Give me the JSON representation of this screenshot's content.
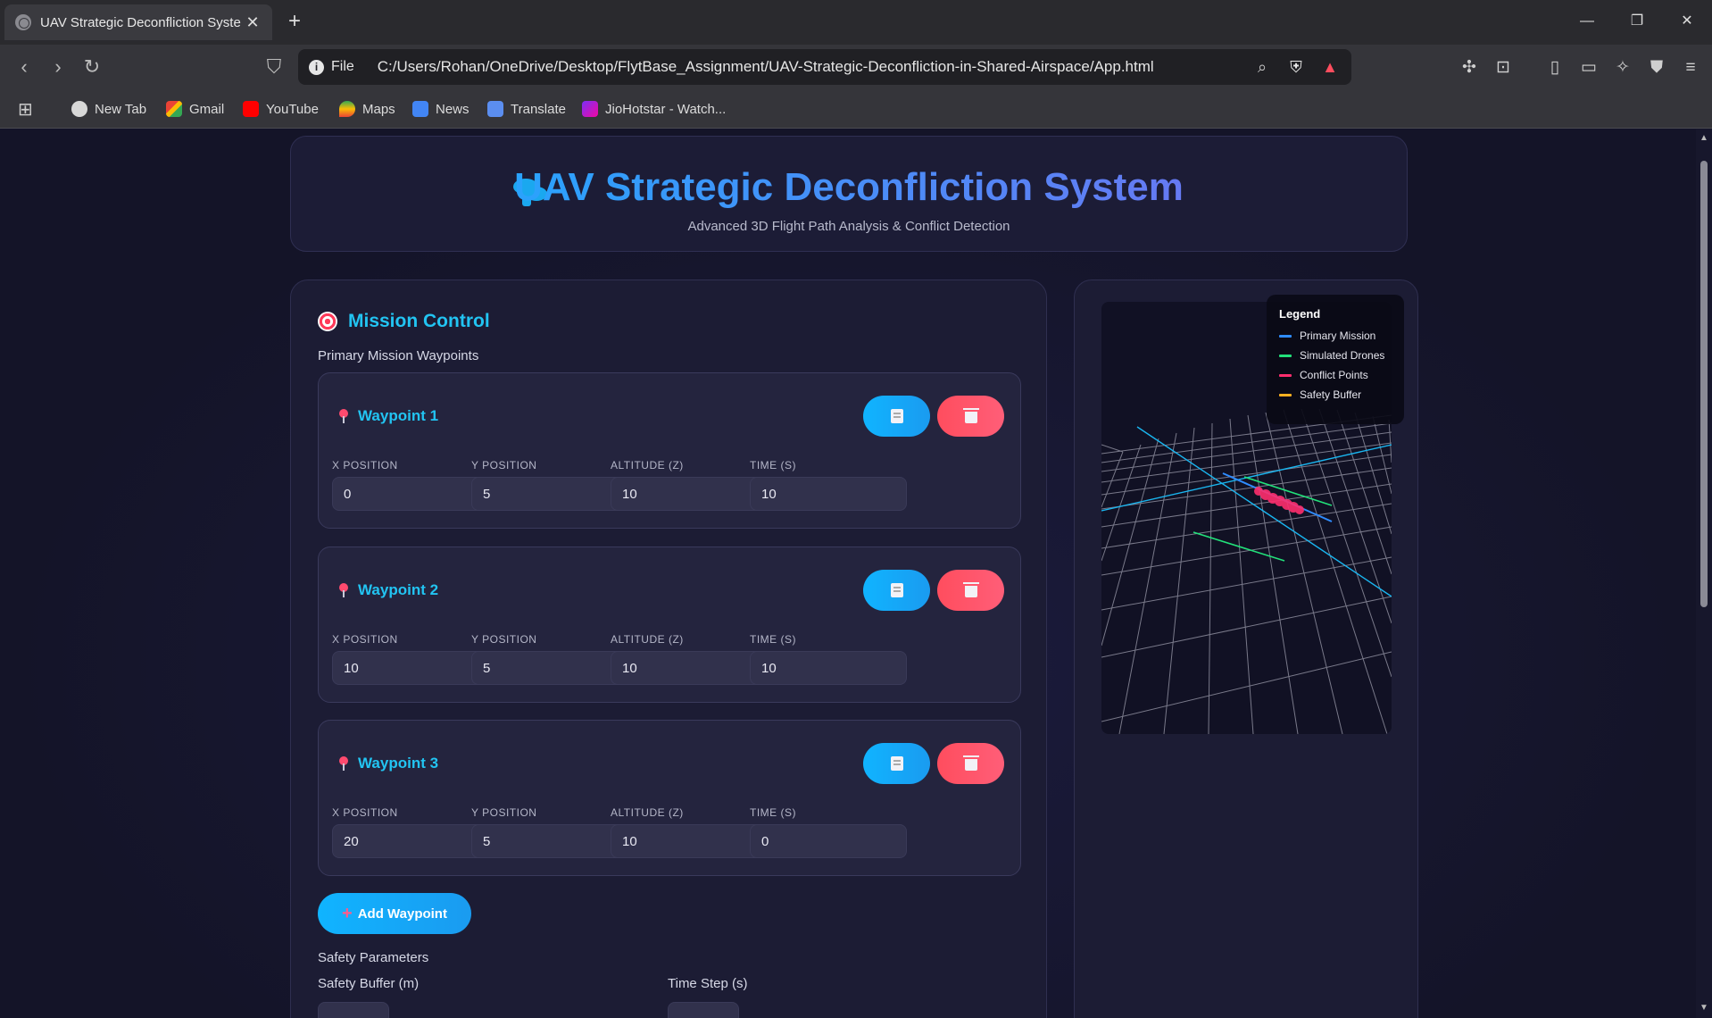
{
  "browser": {
    "tab_title": "UAV Strategic Deconfliction Syste",
    "url_scheme": "File",
    "url": "C:/Users/Rohan/OneDrive/Desktop/FlytBase_Assignment/UAV-Strategic-Deconfliction-in-Shared-Airspace/App.html",
    "bookmarks": [
      "New Tab",
      "Gmail",
      "YouTube",
      "Maps",
      "News",
      "Translate",
      "JioHotstar - Watch..."
    ]
  },
  "header": {
    "title": "UAV Strategic Deconfliction System",
    "subtitle": "Advanced 3D Flight Path Analysis & Conflict Detection"
  },
  "mission": {
    "title": "Mission Control",
    "waypoints_label": "Primary Mission Waypoints",
    "field_labels": {
      "x": "X POSITION",
      "y": "Y POSITION",
      "z": "ALTITUDE (Z)",
      "t": "TIME (S)"
    },
    "waypoints": [
      {
        "name": "Waypoint 1",
        "x": "0",
        "y": "5",
        "z": "10",
        "t": "10"
      },
      {
        "name": "Waypoint 2",
        "x": "10",
        "y": "5",
        "z": "10",
        "t": "10"
      },
      {
        "name": "Waypoint 3",
        "x": "20",
        "y": "5",
        "z": "10",
        "t": "0"
      }
    ],
    "add_waypoint_label": "Add Waypoint",
    "safety_params_label": "Safety Parameters",
    "safety_buffer_label": "Safety Buffer (m)",
    "time_step_label": "Time Step (s)"
  },
  "legend": {
    "title": "Legend",
    "items": [
      {
        "label": "Primary Mission",
        "color": "#2f8cff"
      },
      {
        "label": "Simulated Drones",
        "color": "#22e07a"
      },
      {
        "label": "Conflict Points",
        "color": "#ff2e6e"
      },
      {
        "label": "Safety Buffer",
        "color": "#ffb020"
      }
    ]
  },
  "colors": {
    "accent": "#22c4f2",
    "danger": "#ff4d5e",
    "grid": "#8a8a9a"
  }
}
